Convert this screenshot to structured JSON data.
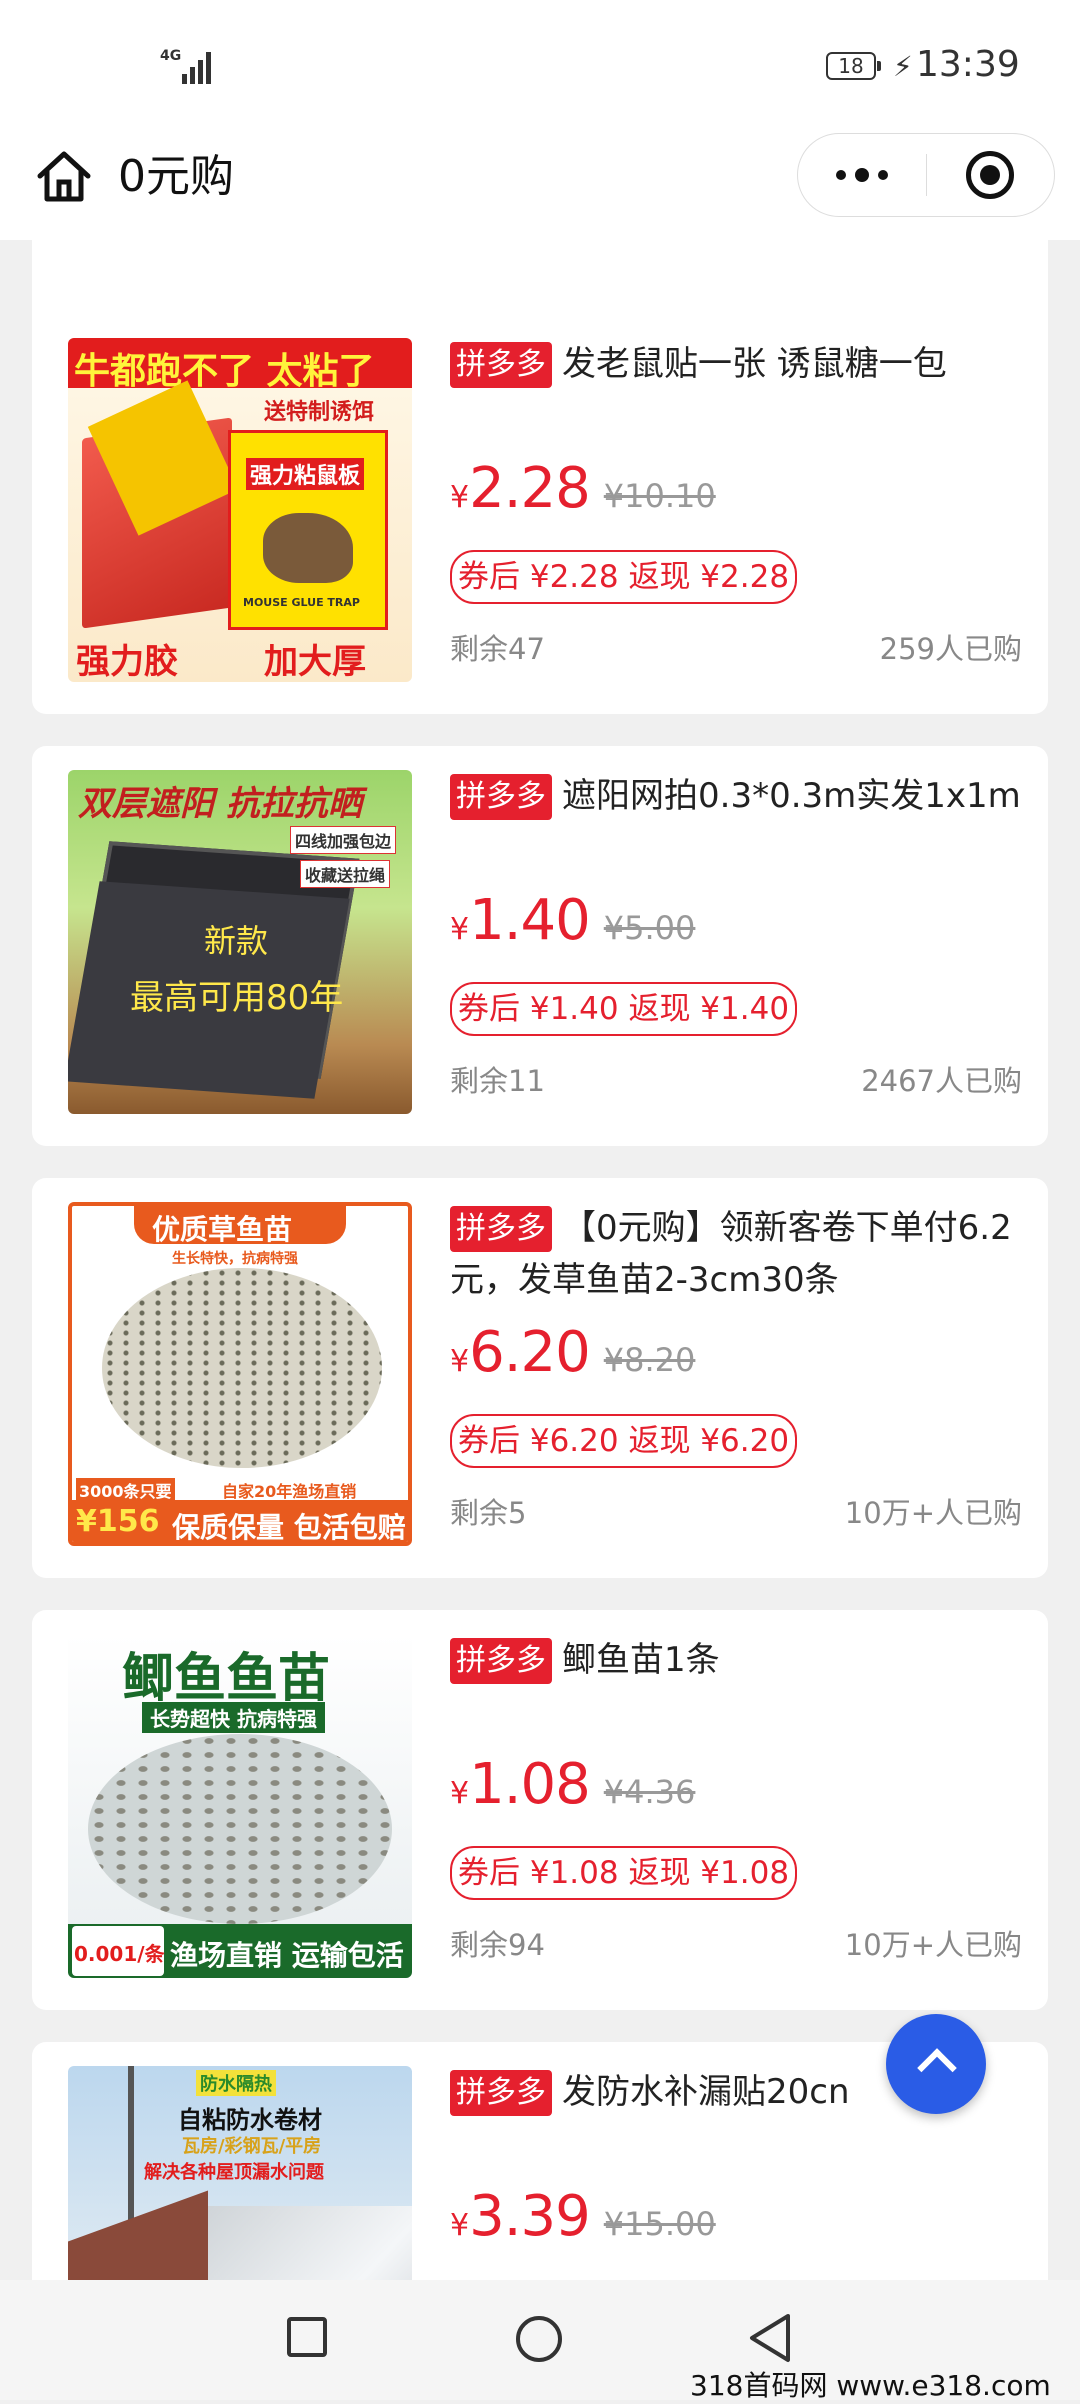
{
  "status": {
    "network": "4G",
    "battery": "18",
    "time": "13:39"
  },
  "header": {
    "title": "0元购"
  },
  "colors": {
    "accent": "#e5202e",
    "fab": "#2a5ce6"
  },
  "products": [
    {
      "image": {
        "top": "牛都跑不了 太粘了",
        "sub": "送特制诱饵",
        "product": "强力粘鼠板",
        "brand": "MOUSE GLUE TRAP",
        "left": "强力胶",
        "right": "加大厚"
      },
      "platform": "拼多多",
      "title": "发老鼠贴一张 诱鼠糖一包",
      "currency": "¥",
      "price": "2.28",
      "original": "¥10.10",
      "coupon": "券后 ¥2.28 返现 ¥2.28",
      "remaining": "剩余47",
      "sold": "259人已购"
    },
    {
      "image": {
        "top": "双层遮阳 抗拉抗晒",
        "tag1": "四线加强包边",
        "tag2": "收藏送拉绳",
        "line1": "新款",
        "line2": "最高可用80年"
      },
      "platform": "拼多多",
      "title": "遮阳网拍0.3*0.3m实发1x1m",
      "currency": "¥",
      "price": "1.40",
      "original": "¥5.00",
      "coupon": "券后 ¥1.40 返现 ¥1.40",
      "remaining": "剩余11",
      "sold": "2467人已购"
    },
    {
      "image": {
        "top": "优质草鱼苗",
        "sub": "生长特快，抗病特强",
        "note": "自家20年渔场直销",
        "count": "3000条只要",
        "price": "¥156",
        "bottom": "保质保量 包活包赔"
      },
      "platform": "拼多多",
      "title": "【0元购】领新客卷下单付6.2元，发草鱼苗2-3cm30条",
      "currency": "¥",
      "price": "6.20",
      "original": "¥8.20",
      "coupon": "券后 ¥6.20 返现 ¥6.20",
      "remaining": "剩余5",
      "sold": "10万+人已购"
    },
    {
      "image": {
        "top": "鲫鱼鱼苗",
        "sub": "长势超快 抗病特强",
        "cost": "0.001/条",
        "bottom": "渔场直销 运输包活"
      },
      "platform": "拼多多",
      "title": "鲫鱼苗1条",
      "currency": "¥",
      "price": "1.08",
      "original": "¥4.36",
      "coupon": "券后 ¥1.08 返现 ¥1.08",
      "remaining": "剩余94",
      "sold": "10万+人已购"
    },
    {
      "image": {
        "top": "防水隔热",
        "sub": "自粘防水卷材",
        "tags": "瓦房/彩钢瓦/平房",
        "line": "解决各种屋顶漏水问题"
      },
      "platform": "拼多多",
      "title": "发防水补漏贴20cn",
      "currency": "¥",
      "price": "3.39",
      "original": "¥15.00"
    }
  ],
  "watermark": "318首码网  www.e318.com"
}
